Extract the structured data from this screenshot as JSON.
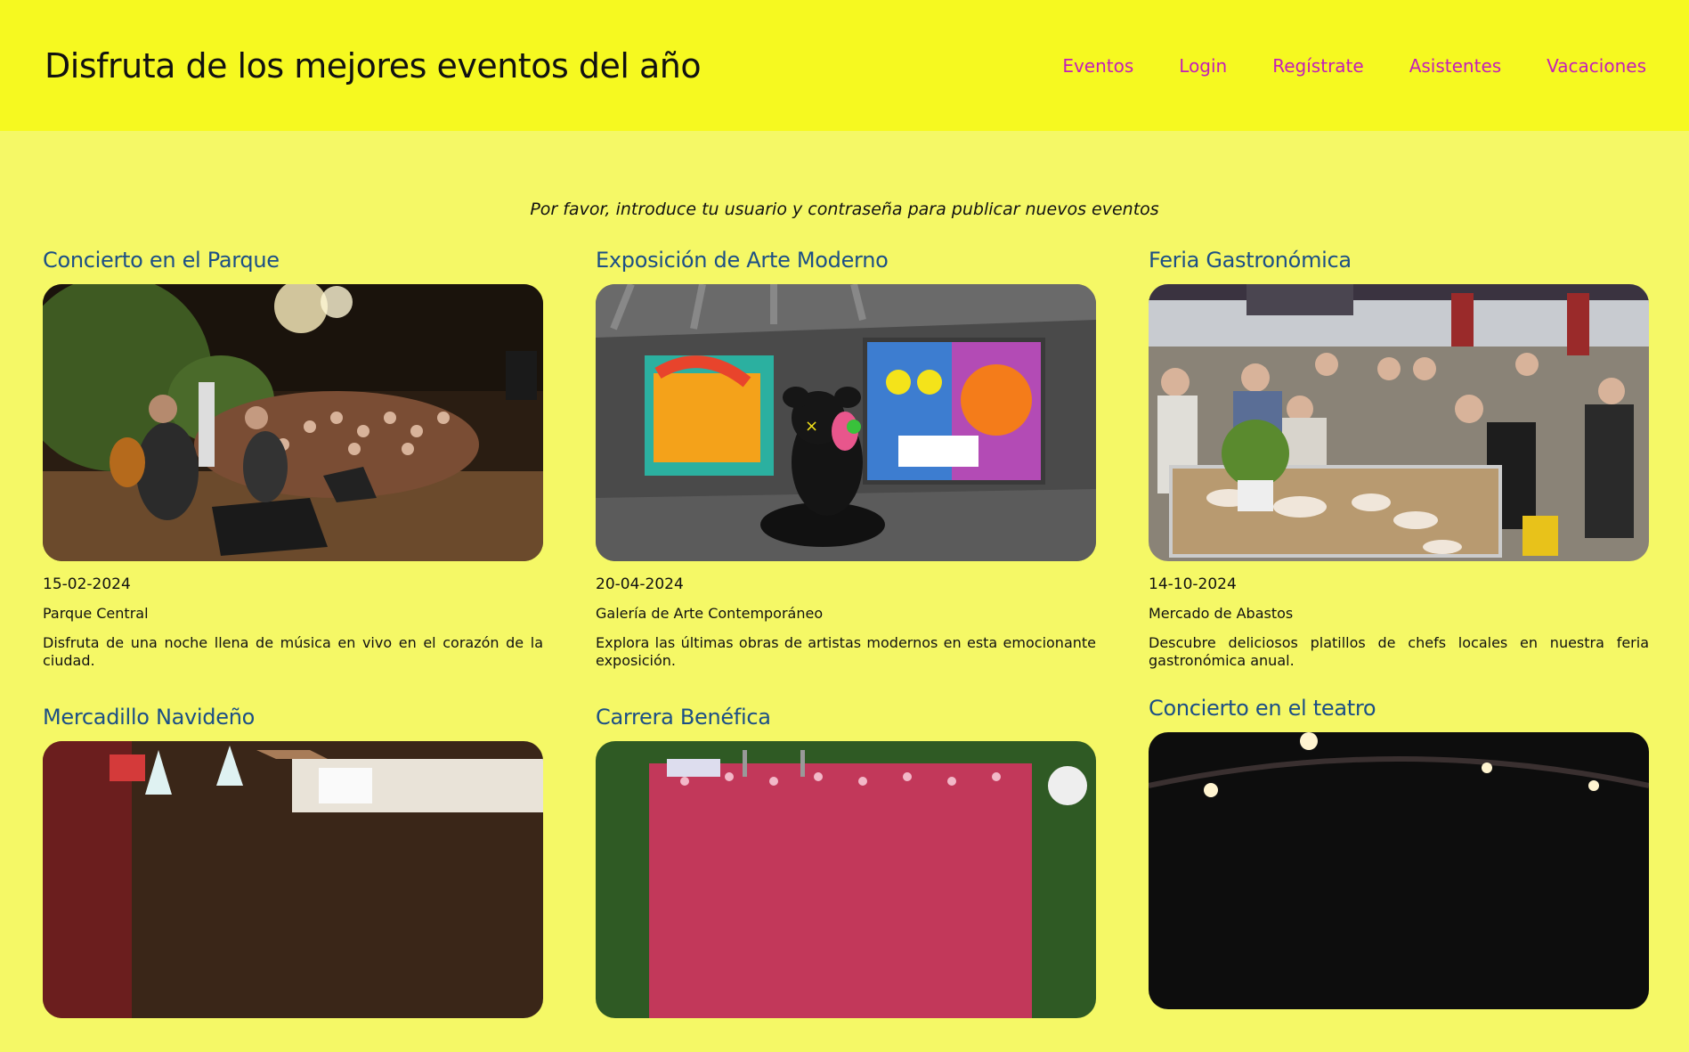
{
  "header": {
    "title": "Disfruta de los mejores eventos del año",
    "nav": [
      "Eventos",
      "Login",
      "Regístrate",
      "Asistentes",
      "Vacaciones"
    ]
  },
  "notice": "Por favor, introduce tu usuario y contraseña para publicar nuevos eventos",
  "events": [
    {
      "title": "Concierto en el Parque",
      "date": "15-02-2024",
      "place": "Parque Central",
      "description": "Disfruta de una noche llena de música en vivo en el corazón de la ciudad."
    },
    {
      "title": "Exposición de Arte Moderno",
      "date": "20-04-2024",
      "place": "Galería de Arte Contemporáneo",
      "description": "Explora las últimas obras de artistas modernos en esta emocionante exposición."
    },
    {
      "title": "Feria Gastronómica",
      "date": "14-10-2024",
      "place": "Mercado de Abastos",
      "description": "Descubre deliciosos platillos de chefs locales en nuestra feria gastronómica anual."
    },
    {
      "title": "Mercadillo Navideño"
    },
    {
      "title": "Carrera Benéfica"
    },
    {
      "title": "Concierto en el teatro"
    }
  ],
  "colors": {
    "header_bg": "#f6f920",
    "page_bg": "#f5f866",
    "nav_link": "#c41fb8",
    "event_title": "#1c4f86"
  }
}
